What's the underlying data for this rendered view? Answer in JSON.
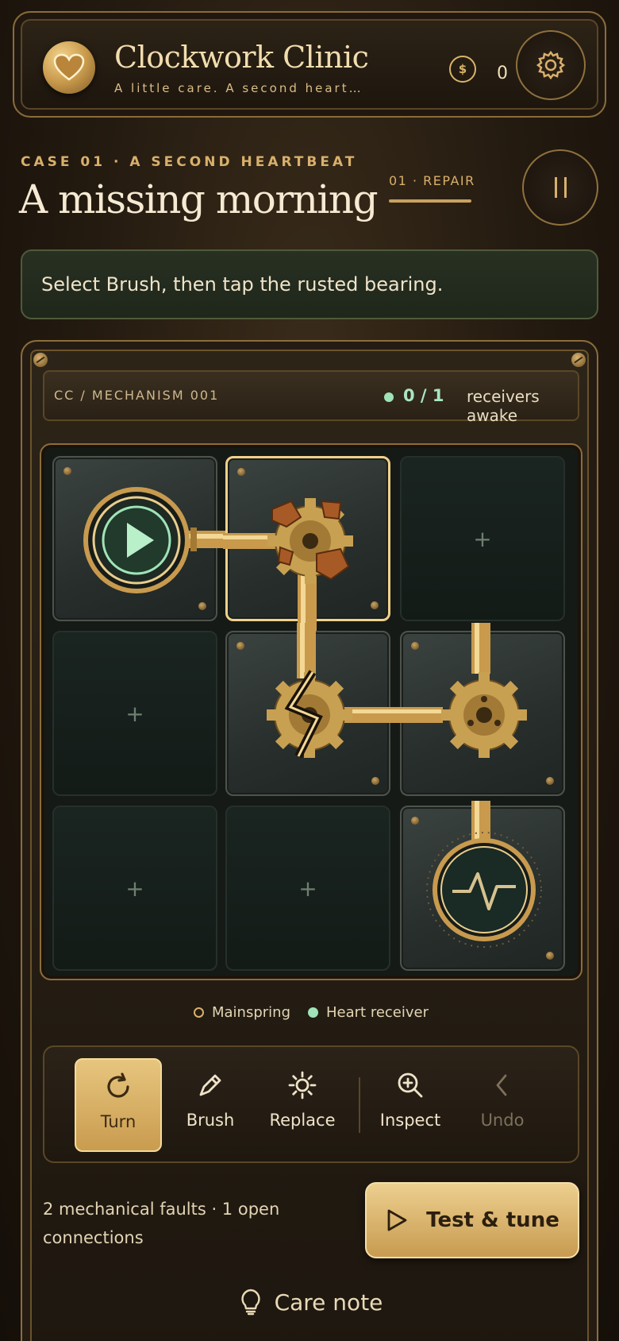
{
  "app": {
    "title": "Clockwork Clinic",
    "subtitle": "A little care. A second heartbe…",
    "coins": "0"
  },
  "case": {
    "label": "CASE 01 · A SECOND HEARTBEAT",
    "title": "A missing morning",
    "stage": "01 · REPAIR"
  },
  "hint": "Select Brush, then tap the rusted bearing.",
  "mechanism": {
    "id": "CC / MECHANISM 001",
    "receivers_count": "0 / 1",
    "receivers_text": "receivers awake"
  },
  "grid": {
    "empty_label": "+",
    "cells": [
      {
        "row": 0,
        "col": 0,
        "type": "mainspring"
      },
      {
        "row": 0,
        "col": 1,
        "type": "rusted-gear",
        "selected": true
      },
      {
        "row": 0,
        "col": 2,
        "type": "empty"
      },
      {
        "row": 1,
        "col": 0,
        "type": "empty"
      },
      {
        "row": 1,
        "col": 1,
        "type": "cracked-gear"
      },
      {
        "row": 1,
        "col": 2,
        "type": "gear"
      },
      {
        "row": 2,
        "col": 0,
        "type": "empty"
      },
      {
        "row": 2,
        "col": 1,
        "type": "empty"
      },
      {
        "row": 2,
        "col": 2,
        "type": "heart-receiver"
      }
    ]
  },
  "legend": {
    "mainspring": "Mainspring",
    "receiver": "Heart receiver"
  },
  "tools": {
    "turn": "Turn",
    "brush": "Brush",
    "replace": "Replace",
    "inspect": "Inspect",
    "undo": "Undo",
    "active": "turn",
    "disabled": "undo"
  },
  "status": "2 mechanical faults · 1 open connections",
  "test_button": "Test & tune",
  "care_note": "Care note",
  "icons": [
    "heart-icon",
    "coin-icon",
    "gear-icon",
    "pause-icon",
    "play-icon",
    "rotate-icon",
    "brush-icon",
    "sun-icon",
    "magnify-icon",
    "chevron-left-icon",
    "lightbulb-icon"
  ],
  "colors": {
    "brass": "#d9b06b",
    "receiver_green": "#9fe3b8",
    "background": "#22190f"
  }
}
